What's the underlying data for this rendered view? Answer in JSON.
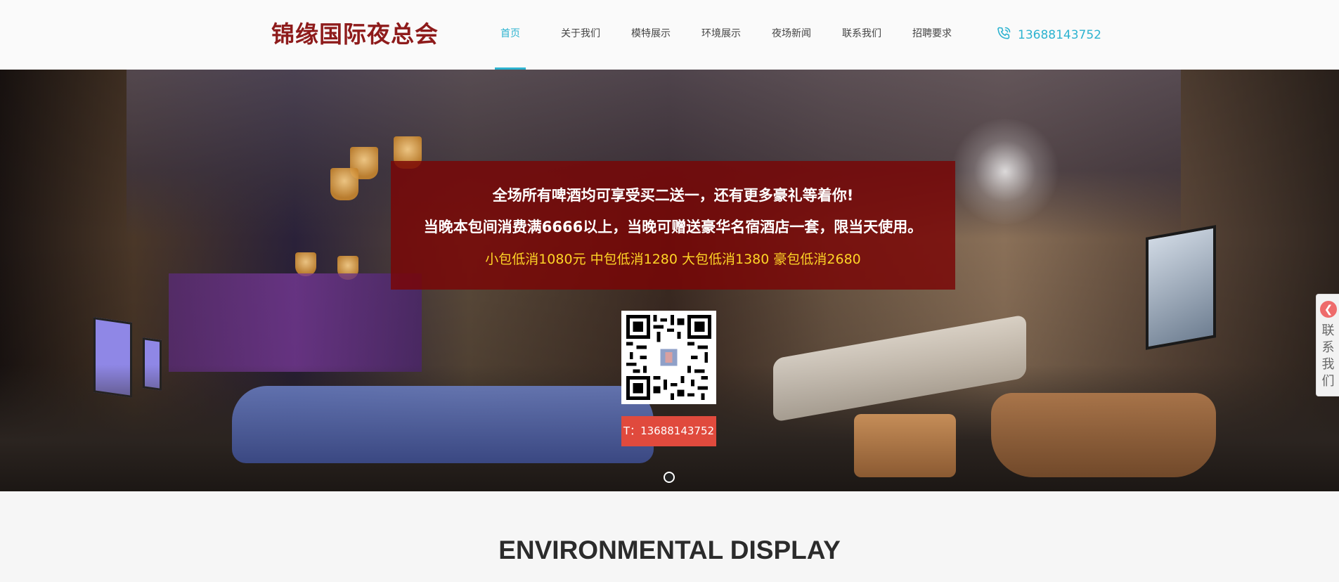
{
  "header": {
    "logo": "锦缘国际夜总会",
    "nav": [
      {
        "label": "首页",
        "active": true
      },
      {
        "label": "关于我们",
        "active": false
      },
      {
        "label": "模特展示",
        "active": false
      },
      {
        "label": "环境展示",
        "active": false
      },
      {
        "label": "夜场新闻",
        "active": false
      },
      {
        "label": "联系我们",
        "active": false
      },
      {
        "label": "招聘要求",
        "active": false
      }
    ],
    "phone": "13688143752",
    "phone_icon": "phone-icon"
  },
  "banner": {
    "promo": {
      "line1": "全场所有啤酒均可享受买二送一，还有更多豪礼等着你!",
      "line2": "当晚本包间消费满6666以上，当晚可赠送豪华名宿酒店一套，限当天使用。",
      "line3": "小包低消1080元 中包低消1280 大包低消1380 豪包低消2680"
    },
    "qr_phone": "T：13688143752",
    "slides_total": 1,
    "slide_active": 1
  },
  "side_tab": {
    "label": "联系我们",
    "icon": "arrow-left-icon"
  },
  "section": {
    "title": "ENVIRONMENTAL DISPLAY"
  },
  "colors": {
    "accent": "#2db3d0",
    "logo": "#8e1b1b",
    "promo_bg": "#7a0505",
    "promo_price": "#ffd426",
    "phone_badge": "#e04a3d"
  }
}
